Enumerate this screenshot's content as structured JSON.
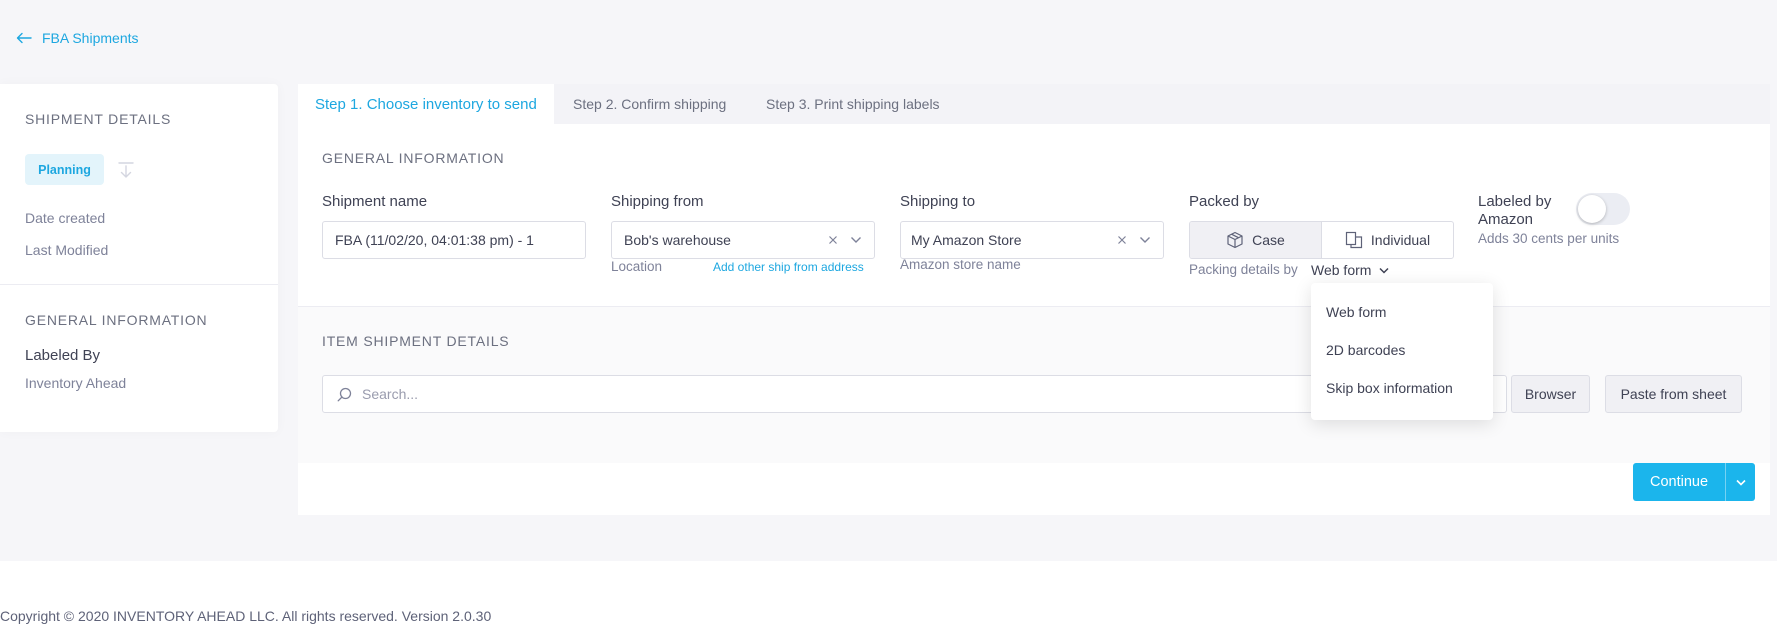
{
  "back_link": {
    "label": "FBA Shipments"
  },
  "sidebar": {
    "shipment_details_title": "SHIPMENT DETAILS",
    "status_badge": "Planning",
    "date_created_label": "Date created",
    "last_modified_label": "Last Modified",
    "general_info_title": "GENERAL INFORMATION",
    "labeled_by_title": "Labeled By",
    "labeled_by_value": "Inventory Ahead"
  },
  "tabs": [
    {
      "label": "Step 1. Choose inventory to send",
      "active": true
    },
    {
      "label": "Step 2. Confirm shipping",
      "active": false
    },
    {
      "label": "Step 3. Print shipping labels",
      "active": false
    }
  ],
  "general": {
    "title": "GENERAL INFORMATION",
    "shipment_name_label": "Shipment name",
    "shipment_name_value": "FBA (11/02/20, 04:01:38 pm) - 1",
    "shipping_from_label": "Shipping from",
    "shipping_from_value": "Bob's warehouse",
    "location_label": "Location",
    "add_address_link": "Add other ship from address",
    "shipping_to_label": "Shipping to",
    "shipping_to_value": "My Amazon Store",
    "amazon_store_label": "Amazon store name",
    "packed_by_label": "Packed by",
    "packed_case": "Case",
    "packed_individual": "Individual",
    "packing_details_label": "Packing details by",
    "packing_details_value": "Web form",
    "labeled_by_amazon_label": "Labeled by Amazon",
    "labeled_by_amazon_on": false,
    "adds_cents_text": "Adds 30 cents per units"
  },
  "packing_dropdown": {
    "options": [
      "Web form",
      "2D barcodes",
      "Skip box information"
    ]
  },
  "items": {
    "title": "ITEM SHIPMENT DETAILS",
    "search_placeholder": "Search...",
    "browser_button": "Browser",
    "paste_button": "Paste from sheet"
  },
  "actions": {
    "continue_label": "Continue"
  },
  "footer": {
    "text": "Copyright © 2020 INVENTORY AHEAD LLC. All rights reserved. Version 2.0.30"
  },
  "colors": {
    "accent": "#1da7e0",
    "primary_button": "#1bb5ec",
    "badge_bg": "#e3f4fb"
  }
}
